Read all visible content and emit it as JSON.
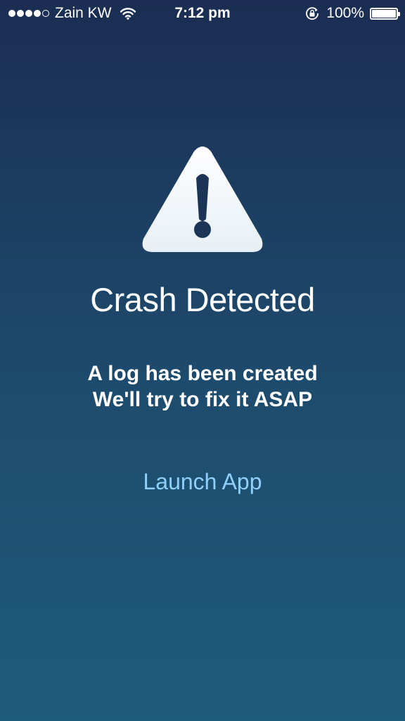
{
  "status_bar": {
    "carrier": "Zain KW",
    "time": "7:12 pm",
    "battery_percent": "100%",
    "signal_bars_filled": 4,
    "signal_bars_total": 5,
    "icons": [
      "signal-icon",
      "wifi-icon",
      "rotation-lock-icon",
      "battery-icon"
    ]
  },
  "alert": {
    "icon": "warning-icon",
    "title": "Crash Detected",
    "message_line1": "A log has been created",
    "message_line2": "We'll try to fix it ASAP",
    "action_label": "Launch App"
  },
  "colors": {
    "background_top": "#1b2d52",
    "background_bottom": "#1f5b7c",
    "accent": "#8fcffb",
    "text": "#ffffff"
  }
}
